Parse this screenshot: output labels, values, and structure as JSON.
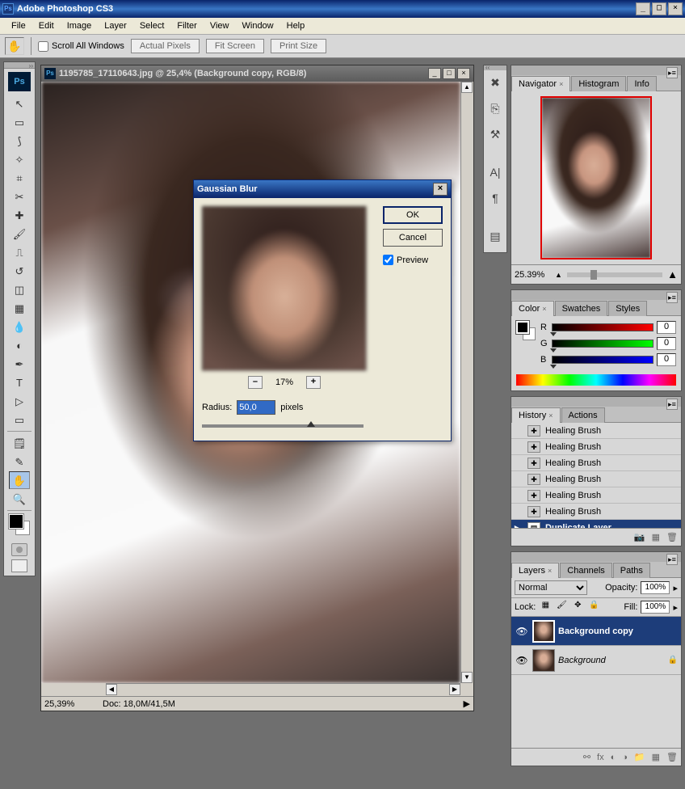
{
  "app": {
    "title": "Adobe Photoshop CS3"
  },
  "menu": [
    "File",
    "Edit",
    "Image",
    "Layer",
    "Select",
    "Filter",
    "View",
    "Window",
    "Help"
  ],
  "options": {
    "scroll_all": "Scroll All Windows",
    "btns": [
      "Actual Pixels",
      "Fit Screen",
      "Print Size"
    ]
  },
  "document": {
    "title": "1195785_17110643.jpg @ 25,4% (Background copy, RGB/8)",
    "zoom": "25,39%",
    "docinfo": "Doc: 18,0M/41,5M"
  },
  "dialog": {
    "title": "Gaussian Blur",
    "ok": "OK",
    "cancel": "Cancel",
    "preview_label": "Preview",
    "zoom_pct": "17%",
    "radius_label": "Radius:",
    "radius_value": "50,0",
    "radius_unit": "pixels"
  },
  "nav": {
    "tabs": [
      "Navigator",
      "Histogram",
      "Info"
    ],
    "zoom": "25.39%"
  },
  "color": {
    "tabs": [
      "Color",
      "Swatches",
      "Styles"
    ],
    "r": "0",
    "g": "0",
    "b": "0"
  },
  "history": {
    "tabs": [
      "History",
      "Actions"
    ],
    "items": [
      "Healing Brush",
      "Healing Brush",
      "Healing Brush",
      "Healing Brush",
      "Healing Brush",
      "Healing Brush",
      "Duplicate Layer"
    ]
  },
  "layers": {
    "tabs": [
      "Layers",
      "Channels",
      "Paths"
    ],
    "blend": "Normal",
    "opacity_label": "Opacity:",
    "opacity": "100%",
    "lock_label": "Lock:",
    "fill_label": "Fill:",
    "fill": "100%",
    "rows": [
      {
        "name": "Background copy",
        "locked": false
      },
      {
        "name": "Background",
        "locked": true
      }
    ]
  }
}
